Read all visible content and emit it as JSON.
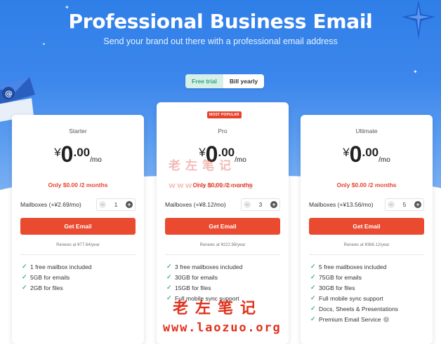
{
  "hero": {
    "title": "Professional Business Email",
    "subtitle": "Send your brand out there with a professional email address"
  },
  "billing_toggle": {
    "options": [
      "Free trial",
      "Bill yearly"
    ],
    "selected": "Free trial"
  },
  "plans": [
    {
      "name": "Starter",
      "badge": "",
      "currency": "¥",
      "price_int": "0",
      "price_dec": ".00",
      "period": "/mo",
      "promo": "Only $0.00 /2 months",
      "mailbox_label": "Mailboxes (+¥2.69/mo)",
      "mailbox_qty": "1",
      "cta": "Get Email",
      "renews": "Renews at ¥77.64/year",
      "features": [
        {
          "text": "1 free mailbox included"
        },
        {
          "text": "5GB for emails"
        },
        {
          "text": "2GB for files"
        }
      ]
    },
    {
      "name": "Pro",
      "badge": "MOST POPULAR",
      "currency": "¥",
      "price_int": "0",
      "price_dec": ".00",
      "period": "/mo",
      "promo": "Only $0.00 /2 months",
      "mailbox_label": "Mailboxes (+¥8.12/mo)",
      "mailbox_qty": "3",
      "cta": "Get Email",
      "renews": "Renews at ¥222.98/year",
      "features": [
        {
          "text": "3 free mailboxes included"
        },
        {
          "text": "30GB for emails"
        },
        {
          "text": "15GB for files"
        },
        {
          "text": "Full mobile sync support"
        }
      ]
    },
    {
      "name": "Ultimate",
      "badge": "",
      "currency": "¥",
      "price_int": "0",
      "price_dec": ".00",
      "period": "/mo",
      "promo": "Only $0.00 /2 months",
      "mailbox_label": "Mailboxes (+¥13.56/mo)",
      "mailbox_qty": "5",
      "cta": "Get Email",
      "renews": "Renews at ¥366.12/year",
      "features": [
        {
          "text": "5 free mailboxes included"
        },
        {
          "text": "75GB for emails"
        },
        {
          "text": "30GB for files"
        },
        {
          "text": "Full mobile sync support"
        },
        {
          "text": "Docs, Sheets & Presentations"
        },
        {
          "text": "Premium Email Service",
          "info": true
        }
      ]
    }
  ],
  "watermark": {
    "cn_small": "老左笔记",
    "url_small": "www.laozuo.org",
    "cn_big": "老左笔记",
    "url_big": "www.laozuo.org"
  },
  "colors": {
    "hero_blue": "#2f7fe8",
    "cta_red": "#ea4a2f",
    "check_green": "#45b08c",
    "promo_red": "#e5432e",
    "toggle_active_bg": "#d6efe8"
  },
  "icons": {
    "check": "check-icon",
    "minus": "minus-icon",
    "plus": "plus-icon",
    "info": "info-icon",
    "envelope": "envelope-icon",
    "star": "star-icon"
  }
}
